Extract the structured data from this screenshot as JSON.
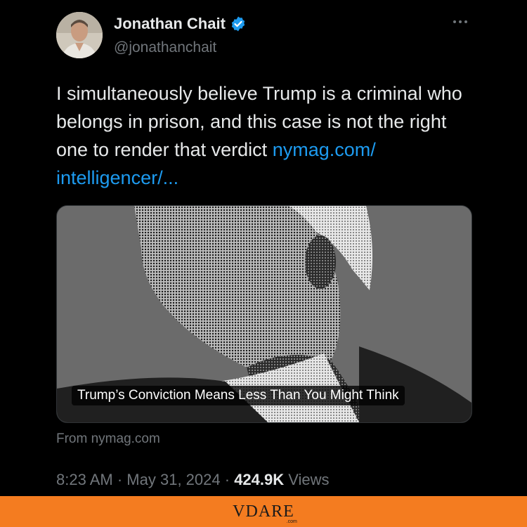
{
  "tweet": {
    "author": {
      "display_name": "Jonathan Chait",
      "handle": "@jonathanchait",
      "verified": true,
      "avatar_icon": "user-photo"
    },
    "more_icon": "more-dots-icon",
    "text": "I simultaneously believe Trump is a criminal who belongs in prison, and this case is not the right one to render that verdict",
    "link_text": "nymag.com/intelligencer/...",
    "link_text_line1": "nymag.com/",
    "link_text_line2": "intelligencer/...",
    "card": {
      "headline": "Trump’s Conviction Means Less Than You Might Think",
      "source": "From nymag.com",
      "image_icon": "halftone-portrait-image"
    },
    "time": "8:23 AM",
    "date": "May 31, 2024",
    "separator": "·",
    "views_count": "424.9K",
    "views_label": "Views"
  },
  "banner": {
    "brand": "VDARE",
    "brand_sub": ".com",
    "color": "#f47c20"
  },
  "colors": {
    "background": "#000000",
    "text": "#e7e9ea",
    "secondary": "#71767b",
    "link": "#1d9bf0",
    "verified": "#1d9bf0"
  }
}
